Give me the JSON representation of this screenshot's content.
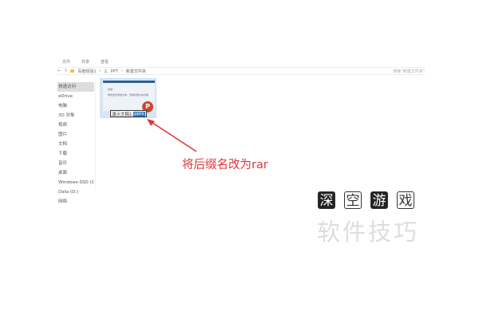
{
  "ribbon": {
    "tabs": [
      "文件",
      "共享",
      "查看"
    ]
  },
  "address": {
    "path": [
      "百度经验1",
      "2、PPT",
      "新建文件夹"
    ],
    "search_placeholder": "搜索\"新建文件夹\""
  },
  "sidebar": {
    "items": [
      "快速访问",
      "eDrive",
      "电脑",
      "3D 对象",
      "视频",
      "图片",
      "文档",
      "下载",
      "音乐",
      "桌面",
      "Windows-SSD (C:)",
      "Data (D:)",
      "网络"
    ]
  },
  "file": {
    "name_base": "演示文稿1.",
    "name_ext": "pptx",
    "slide_text": [
      "标题",
      "单击此处添加文本，添加标题文本内容"
    ],
    "icon_letter": "P"
  },
  "annotation": {
    "text": "将后缀名改为rar",
    "color": "#e2343a"
  },
  "watermark": {
    "top": [
      "深",
      "空",
      "游",
      "戏"
    ],
    "bottom": "软件技巧"
  }
}
